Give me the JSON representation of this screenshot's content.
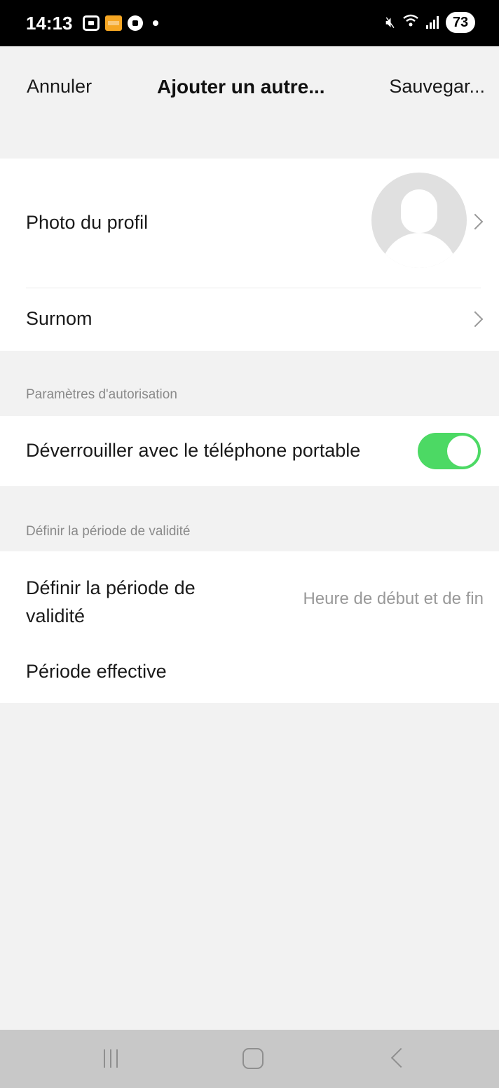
{
  "status_bar": {
    "time": "14:13",
    "battery": "73",
    "left_icons": [
      "screenshot-icon",
      "app-notification-icon",
      "soccer-ball-icon",
      "dot-icon"
    ],
    "right_icons": [
      "mute-icon",
      "wifi-icon",
      "signal-icon",
      "battery-icon"
    ]
  },
  "header": {
    "cancel_label": "Annuler",
    "title": "Ajouter un autre...",
    "save_label": "Sauvegar..."
  },
  "profile": {
    "photo_label": "Photo du profil",
    "nickname_label": "Surnom"
  },
  "authorization": {
    "caption": "Paramètres d'autorisation",
    "unlock_label": "Déverrouiller avec le téléphone portable",
    "unlock_enabled": true
  },
  "validity": {
    "caption": "Définir la période de validité",
    "define_label": "Définir la période de validité",
    "define_value": "Heure de début et de fin",
    "effective_label": "Période effective"
  },
  "colors": {
    "toggle_on": "#4cd964",
    "background": "#f2f2f2",
    "card": "#ffffff",
    "caption_text": "#8a8a8a"
  }
}
